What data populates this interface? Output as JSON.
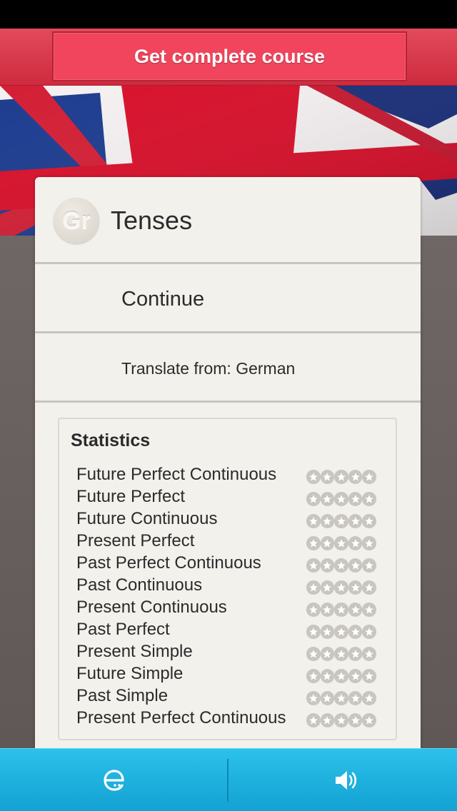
{
  "banner": {
    "button_label": "Get complete course",
    "background_color": "#cf2a3e",
    "button_color": "#f0455c"
  },
  "course": {
    "avatar_text": "Gr",
    "title": "Tenses"
  },
  "actions": {
    "continue_label": "Continue",
    "translate_label": "Translate from: German"
  },
  "statistics": {
    "title": "Statistics",
    "max_stars": 5,
    "items": [
      {
        "label": "Future Perfect Continuous",
        "stars": 0
      },
      {
        "label": "Future Perfect",
        "stars": 0
      },
      {
        "label": "Future Continuous",
        "stars": 0
      },
      {
        "label": "Present Perfect",
        "stars": 0
      },
      {
        "label": "Past Perfect Continuous",
        "stars": 0
      },
      {
        "label": "Past Continuous",
        "stars": 0
      },
      {
        "label": "Present Continuous",
        "stars": 0
      },
      {
        "label": "Past Perfect",
        "stars": 0
      },
      {
        "label": "Present Simple",
        "stars": 0
      },
      {
        "label": "Future Simple",
        "stars": 0
      },
      {
        "label": "Past Simple",
        "stars": 0
      },
      {
        "label": "Present Perfect Continuous",
        "stars": 0
      }
    ]
  },
  "bottom_bar": {
    "background_color": "#13a2d3",
    "left_icon": "e-letter-icon",
    "right_icon": "speaker-icon"
  },
  "header_image": "union-jack-flag"
}
